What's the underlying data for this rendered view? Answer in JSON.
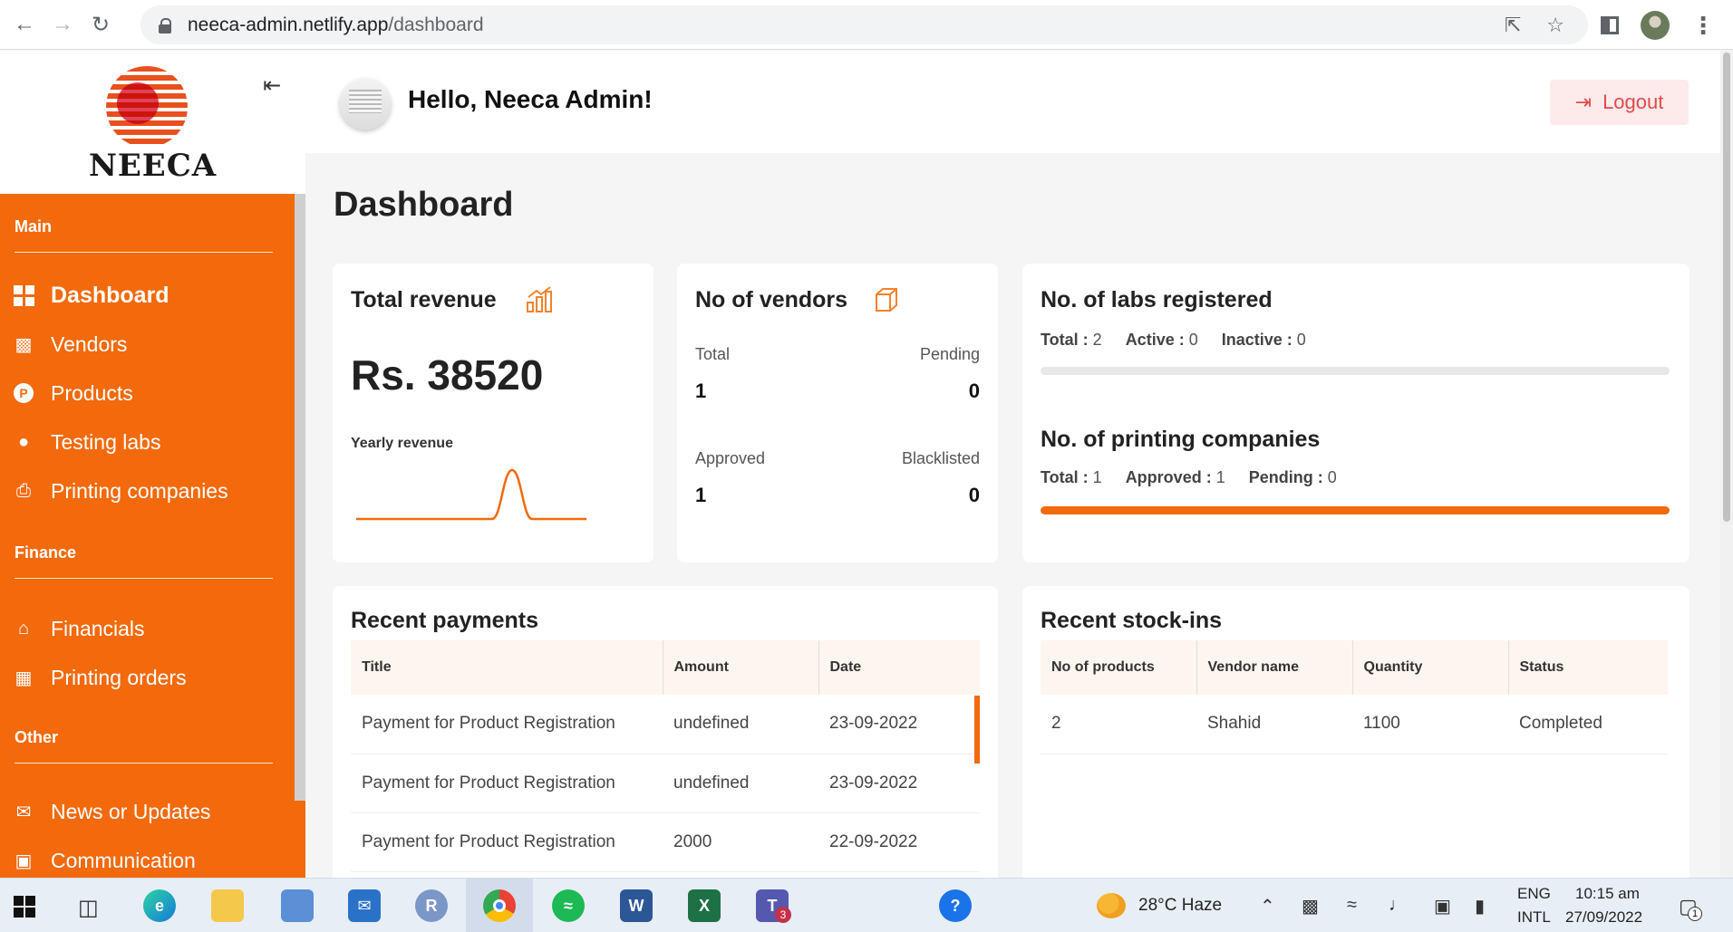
{
  "browser": {
    "url_host": "neeca-admin.netlify.app",
    "url_path": "/dashboard"
  },
  "sidebar": {
    "logo_text": "NEECA",
    "sections": [
      {
        "title": "Main",
        "items": [
          {
            "label": "Dashboard",
            "icon": "dashboard-grid-icon",
            "active": true
          },
          {
            "label": "Vendors",
            "icon": "factory-icon"
          },
          {
            "label": "Products",
            "icon": "product-p-icon"
          },
          {
            "label": "Testing labs",
            "icon": "lightbulb-icon"
          },
          {
            "label": "Printing companies",
            "icon": "printer-icon"
          }
        ]
      },
      {
        "title": "Finance",
        "items": [
          {
            "label": "Financials",
            "icon": "bank-icon"
          },
          {
            "label": "Printing orders",
            "icon": "chart-box-icon"
          }
        ]
      },
      {
        "title": "Other",
        "items": [
          {
            "label": "News or Updates",
            "icon": "megaphone-icon"
          },
          {
            "label": "Communication",
            "icon": "chat-icon"
          }
        ]
      }
    ]
  },
  "header": {
    "greeting": "Hello, Neeca Admin!",
    "logout_label": "Logout"
  },
  "page": {
    "title": "Dashboard"
  },
  "revenue_card": {
    "title": "Total revenue",
    "value": "Rs. 38520",
    "chart_label": "Yearly revenue"
  },
  "vendors_card": {
    "title": "No of vendors",
    "total_label": "Total",
    "total_value": "1",
    "pending_label": "Pending",
    "pending_value": "0",
    "approved_label": "Approved",
    "approved_value": "1",
    "blacklisted_label": "Blacklisted",
    "blacklisted_value": "0"
  },
  "labs_card": {
    "title": "No. of labs registered",
    "total_label": "Total :",
    "total_value": "2",
    "active_label": "Active :",
    "active_value": "0",
    "inactive_label": "Inactive :",
    "inactive_value": "0",
    "progress_fraction": 0
  },
  "printing_card": {
    "title": "No. of printing companies",
    "total_label": "Total :",
    "total_value": "1",
    "approved_label": "Approved :",
    "approved_value": "1",
    "pending_label": "Pending :",
    "pending_value": "0",
    "progress_fraction": 1
  },
  "payments": {
    "title": "Recent payments",
    "headers": [
      "Title",
      "Amount",
      "Date"
    ],
    "rows": [
      [
        "Payment for Product Registration",
        "undefined",
        "23-09-2022"
      ],
      [
        "Payment for Product Registration",
        "undefined",
        "23-09-2022"
      ],
      [
        "Payment for Product Registration",
        "2000",
        "22-09-2022"
      ]
    ]
  },
  "stockins": {
    "title": "Recent stock-ins",
    "headers": [
      "No of products",
      "Vendor name",
      "Quantity",
      "Status"
    ],
    "rows": [
      [
        "2",
        "Shahid",
        "1100",
        "Completed"
      ]
    ]
  },
  "taskbar": {
    "weather": "28°C Haze",
    "lang_top": "ENG",
    "lang_bottom": "INTL",
    "time": "10:15 am",
    "date": "27/09/2022",
    "notification_count": "1",
    "teams_badge": "3"
  },
  "colors": {
    "accent": "#f26a0c",
    "logout_text": "#e14b4b"
  }
}
